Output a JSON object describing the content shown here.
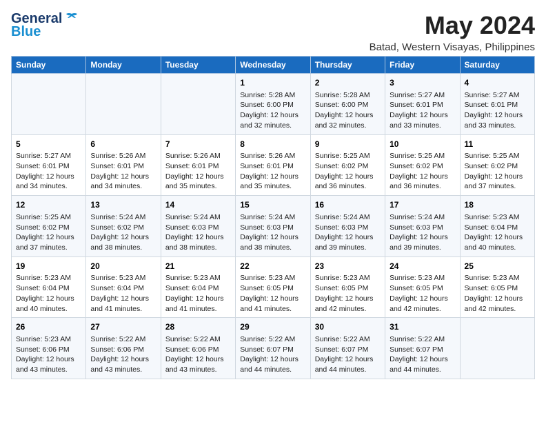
{
  "header": {
    "logo_general": "General",
    "logo_blue": "Blue",
    "main_title": "May 2024",
    "subtitle": "Batad, Western Visayas, Philippines"
  },
  "calendar": {
    "columns": [
      "Sunday",
      "Monday",
      "Tuesday",
      "Wednesday",
      "Thursday",
      "Friday",
      "Saturday"
    ],
    "rows": [
      [
        {
          "day": "",
          "lines": []
        },
        {
          "day": "",
          "lines": []
        },
        {
          "day": "",
          "lines": []
        },
        {
          "day": "1",
          "lines": [
            "Sunrise: 5:28 AM",
            "Sunset: 6:00 PM",
            "Daylight: 12 hours",
            "and 32 minutes."
          ]
        },
        {
          "day": "2",
          "lines": [
            "Sunrise: 5:28 AM",
            "Sunset: 6:00 PM",
            "Daylight: 12 hours",
            "and 32 minutes."
          ]
        },
        {
          "day": "3",
          "lines": [
            "Sunrise: 5:27 AM",
            "Sunset: 6:01 PM",
            "Daylight: 12 hours",
            "and 33 minutes."
          ]
        },
        {
          "day": "4",
          "lines": [
            "Sunrise: 5:27 AM",
            "Sunset: 6:01 PM",
            "Daylight: 12 hours",
            "and 33 minutes."
          ]
        }
      ],
      [
        {
          "day": "5",
          "lines": [
            "Sunrise: 5:27 AM",
            "Sunset: 6:01 PM",
            "Daylight: 12 hours",
            "and 34 minutes."
          ]
        },
        {
          "day": "6",
          "lines": [
            "Sunrise: 5:26 AM",
            "Sunset: 6:01 PM",
            "Daylight: 12 hours",
            "and 34 minutes."
          ]
        },
        {
          "day": "7",
          "lines": [
            "Sunrise: 5:26 AM",
            "Sunset: 6:01 PM",
            "Daylight: 12 hours",
            "and 35 minutes."
          ]
        },
        {
          "day": "8",
          "lines": [
            "Sunrise: 5:26 AM",
            "Sunset: 6:01 PM",
            "Daylight: 12 hours",
            "and 35 minutes."
          ]
        },
        {
          "day": "9",
          "lines": [
            "Sunrise: 5:25 AM",
            "Sunset: 6:02 PM",
            "Daylight: 12 hours",
            "and 36 minutes."
          ]
        },
        {
          "day": "10",
          "lines": [
            "Sunrise: 5:25 AM",
            "Sunset: 6:02 PM",
            "Daylight: 12 hours",
            "and 36 minutes."
          ]
        },
        {
          "day": "11",
          "lines": [
            "Sunrise: 5:25 AM",
            "Sunset: 6:02 PM",
            "Daylight: 12 hours",
            "and 37 minutes."
          ]
        }
      ],
      [
        {
          "day": "12",
          "lines": [
            "Sunrise: 5:25 AM",
            "Sunset: 6:02 PM",
            "Daylight: 12 hours",
            "and 37 minutes."
          ]
        },
        {
          "day": "13",
          "lines": [
            "Sunrise: 5:24 AM",
            "Sunset: 6:02 PM",
            "Daylight: 12 hours",
            "and 38 minutes."
          ]
        },
        {
          "day": "14",
          "lines": [
            "Sunrise: 5:24 AM",
            "Sunset: 6:03 PM",
            "Daylight: 12 hours",
            "and 38 minutes."
          ]
        },
        {
          "day": "15",
          "lines": [
            "Sunrise: 5:24 AM",
            "Sunset: 6:03 PM",
            "Daylight: 12 hours",
            "and 38 minutes."
          ]
        },
        {
          "day": "16",
          "lines": [
            "Sunrise: 5:24 AM",
            "Sunset: 6:03 PM",
            "Daylight: 12 hours",
            "and 39 minutes."
          ]
        },
        {
          "day": "17",
          "lines": [
            "Sunrise: 5:24 AM",
            "Sunset: 6:03 PM",
            "Daylight: 12 hours",
            "and 39 minutes."
          ]
        },
        {
          "day": "18",
          "lines": [
            "Sunrise: 5:23 AM",
            "Sunset: 6:04 PM",
            "Daylight: 12 hours",
            "and 40 minutes."
          ]
        }
      ],
      [
        {
          "day": "19",
          "lines": [
            "Sunrise: 5:23 AM",
            "Sunset: 6:04 PM",
            "Daylight: 12 hours",
            "and 40 minutes."
          ]
        },
        {
          "day": "20",
          "lines": [
            "Sunrise: 5:23 AM",
            "Sunset: 6:04 PM",
            "Daylight: 12 hours",
            "and 41 minutes."
          ]
        },
        {
          "day": "21",
          "lines": [
            "Sunrise: 5:23 AM",
            "Sunset: 6:04 PM",
            "Daylight: 12 hours",
            "and 41 minutes."
          ]
        },
        {
          "day": "22",
          "lines": [
            "Sunrise: 5:23 AM",
            "Sunset: 6:05 PM",
            "Daylight: 12 hours",
            "and 41 minutes."
          ]
        },
        {
          "day": "23",
          "lines": [
            "Sunrise: 5:23 AM",
            "Sunset: 6:05 PM",
            "Daylight: 12 hours",
            "and 42 minutes."
          ]
        },
        {
          "day": "24",
          "lines": [
            "Sunrise: 5:23 AM",
            "Sunset: 6:05 PM",
            "Daylight: 12 hours",
            "and 42 minutes."
          ]
        },
        {
          "day": "25",
          "lines": [
            "Sunrise: 5:23 AM",
            "Sunset: 6:05 PM",
            "Daylight: 12 hours",
            "and 42 minutes."
          ]
        }
      ],
      [
        {
          "day": "26",
          "lines": [
            "Sunrise: 5:23 AM",
            "Sunset: 6:06 PM",
            "Daylight: 12 hours",
            "and 43 minutes."
          ]
        },
        {
          "day": "27",
          "lines": [
            "Sunrise: 5:22 AM",
            "Sunset: 6:06 PM",
            "Daylight: 12 hours",
            "and 43 minutes."
          ]
        },
        {
          "day": "28",
          "lines": [
            "Sunrise: 5:22 AM",
            "Sunset: 6:06 PM",
            "Daylight: 12 hours",
            "and 43 minutes."
          ]
        },
        {
          "day": "29",
          "lines": [
            "Sunrise: 5:22 AM",
            "Sunset: 6:07 PM",
            "Daylight: 12 hours",
            "and 44 minutes."
          ]
        },
        {
          "day": "30",
          "lines": [
            "Sunrise: 5:22 AM",
            "Sunset: 6:07 PM",
            "Daylight: 12 hours",
            "and 44 minutes."
          ]
        },
        {
          "day": "31",
          "lines": [
            "Sunrise: 5:22 AM",
            "Sunset: 6:07 PM",
            "Daylight: 12 hours",
            "and 44 minutes."
          ]
        },
        {
          "day": "",
          "lines": []
        }
      ]
    ]
  }
}
